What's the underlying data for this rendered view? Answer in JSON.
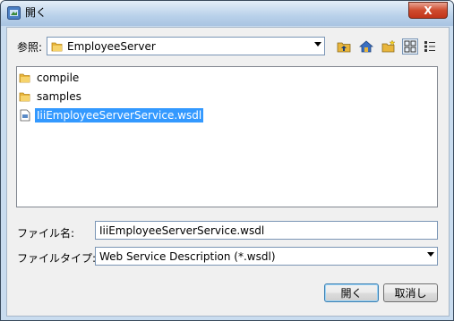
{
  "window": {
    "title": "開く",
    "close_symbol": "X"
  },
  "lookin": {
    "label": "参照:",
    "value": "EmployeeServer"
  },
  "toolbar": {
    "icons": [
      "up-folder-icon",
      "home-icon",
      "new-folder-icon",
      "list-view-icon",
      "details-view-icon"
    ]
  },
  "files": [
    {
      "name": "compile",
      "type": "folder",
      "selected": false
    },
    {
      "name": "samples",
      "type": "folder",
      "selected": false
    },
    {
      "name": "IiiEmployeeServerService.wsdl",
      "type": "wsdl",
      "selected": true
    }
  ],
  "filename": {
    "label": "ファイル名:",
    "value": "IiiEmployeeServerService.wsdl"
  },
  "filetype": {
    "label": "ファイルタイプ:",
    "value": "Web Service Description (*.wsdl)"
  },
  "buttons": {
    "open": "開く",
    "cancel": "取消し"
  },
  "colors": {
    "selection": "#3399ff",
    "close_button": "#cf4b2e",
    "folder": "#e8b53b"
  }
}
